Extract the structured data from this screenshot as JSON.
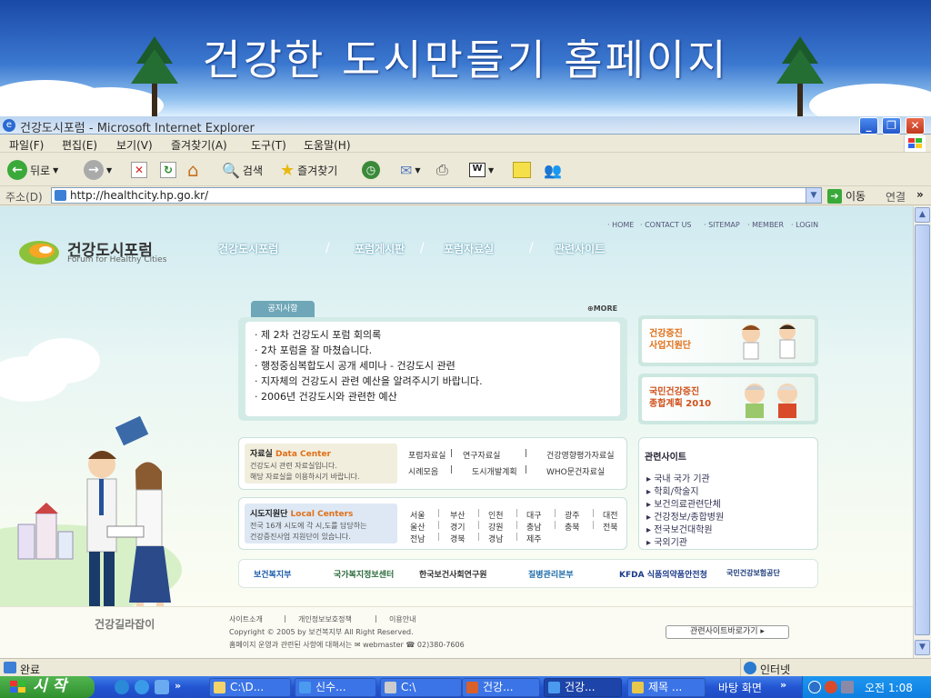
{
  "banner": {
    "title": "건강한 도시만들기 홈페이지"
  },
  "window": {
    "title": "건강도시포럼 - Microsoft Internet Explorer"
  },
  "menu": [
    "파일(F)",
    "편집(E)",
    "보기(V)",
    "즐겨찾기(A)",
    "도구(T)",
    "도움말(H)"
  ],
  "toolbar": {
    "back": "뒤로",
    "search": "검색",
    "favorites": "즐겨찾기"
  },
  "address": {
    "label": "주소(D)",
    "url": "http://healthcity.hp.go.kr/",
    "go": "이동",
    "links": "연결"
  },
  "site": {
    "topnav": [
      "· HOME",
      "· CONTACT US",
      "· SITEMAP",
      "· MEMBER",
      "· LOGIN"
    ],
    "logo_name": "건강도시포럼",
    "logo_sub": "Forum for Healthy Cities",
    "gnav": [
      "건강도시포럼",
      "포럼게시판",
      "포럼자료실",
      "관련사이트"
    ],
    "notice_tab": "공지사항",
    "more": "MORE",
    "notices": [
      "· 제 2차 건강도시 포럼 회의록",
      "· 2차 포럼을 잘 마쳤습니다.",
      "· 행정중심복합도시 공개 세미나 - 건강도시 관련",
      "· 지자체의 건강도시 관련 예산을 알려주시기 바랍니다.",
      "· 2006년 건강도시와 관련한 예산"
    ],
    "side1": [
      "건강증진",
      "사업지원단"
    ],
    "side2": [
      "국민건강증진",
      "종합계획 2010"
    ],
    "datacenter": {
      "title_ko": "자료실",
      "title_en": "Data Center",
      "desc": [
        "건강도시 관련 자료실입니다.",
        "해당 자료실을 이용하시기 바랍니다."
      ],
      "links": [
        "포럼자료실",
        "|",
        "연구자료실",
        "|",
        "건강영향평가자료실",
        "시례모음",
        "|",
        "도시개발계획",
        "|",
        "WHO문건자료실"
      ]
    },
    "local": {
      "title_ko": "시도지원단",
      "title_en": "Local Centers",
      "desc": [
        "전국 16개 시도에 각 시,도를 담당하는",
        "건강증진사업 지원단이 있습니다."
      ],
      "regions": [
        "서울",
        "부산",
        "인천",
        "대구",
        "광주",
        "대전",
        "울산",
        "경기",
        "강원",
        "충남",
        "충북",
        "전북",
        "전남",
        "경북",
        "경남",
        "제주"
      ]
    },
    "related_title": "관련사이트",
    "related": [
      "▸ 국내 국가 기관",
      "▸ 학회/학술지",
      "▸ 보건의료관련단체",
      "▸ 건강정보/종합병원",
      "▸ 전국보건대학원",
      "▸ 국외기관"
    ],
    "orgs": [
      "보건복지부",
      "국가복지정보센터",
      "한국보건사회연구원",
      "질병관리본부",
      "KFDA 식품의약품안전청",
      "국민건강보험공단"
    ],
    "footer_logo": "건강길라잡이",
    "footer_links": [
      "사이트소개",
      "|",
      "개인정보보호정책",
      "|",
      "이용안내"
    ],
    "copyright": "Copyright © 2005 by 보건복지부 All Right Reserved.",
    "contact": "홈페이지 운영과 관련된 사항에 대해서는 ✉ webmaster ☎ 02)380-7606",
    "footer_btn": "관련사이트바로가기 ▸"
  },
  "status": {
    "text": "완료",
    "zone": "인터넷"
  },
  "taskbar": {
    "start": "시 작",
    "tasks": [
      "C:\\D...",
      "신수...",
      "C:\\",
      "건강...",
      "건강...",
      "제목 ...",
      "바탕 화면"
    ],
    "clock": "오전 1:08"
  }
}
